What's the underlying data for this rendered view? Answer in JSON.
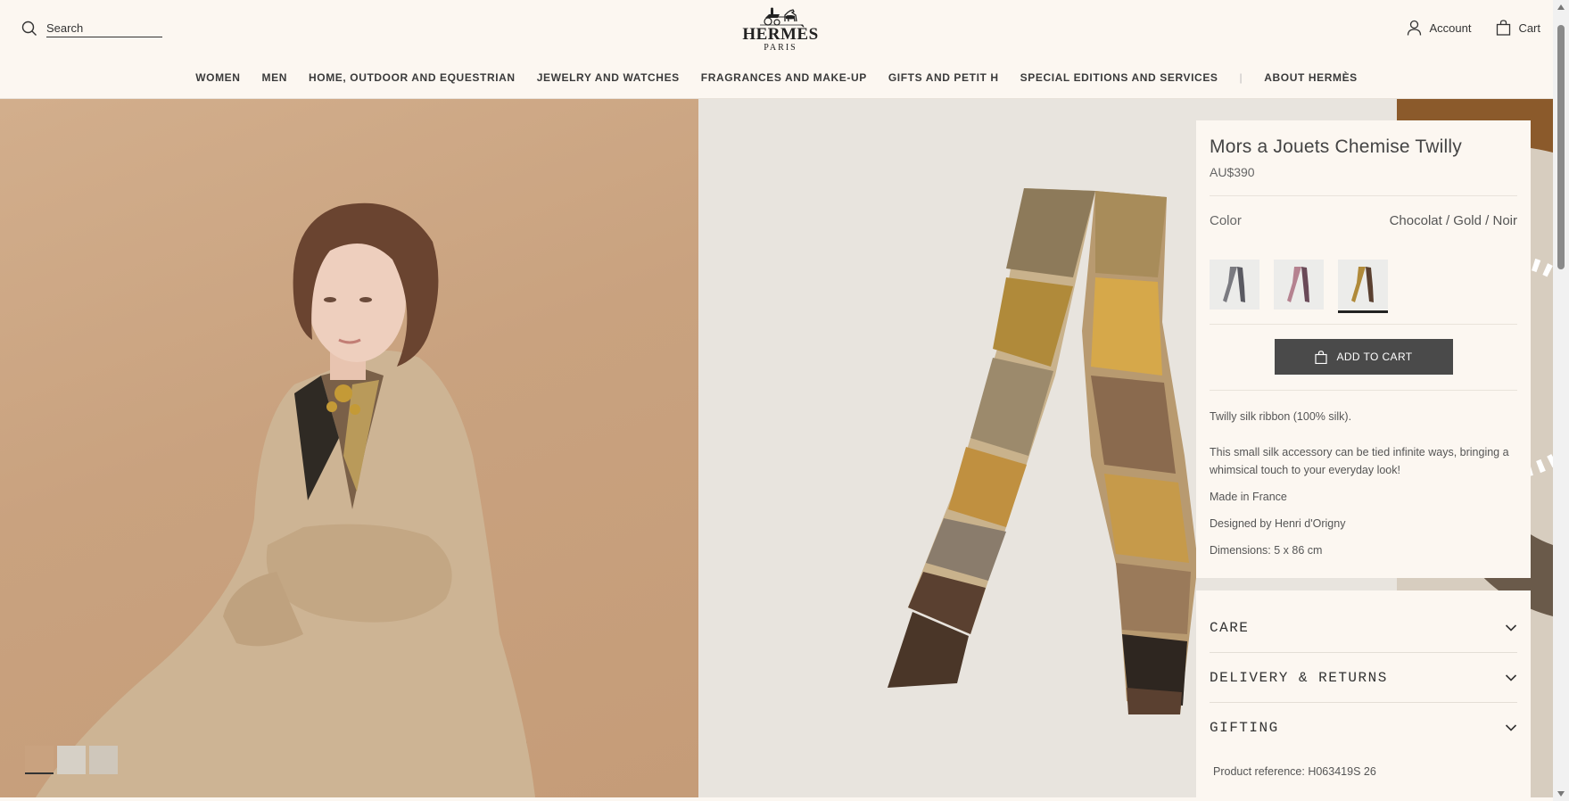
{
  "header": {
    "search_placeholder": "Search",
    "logo": {
      "main": "HERMÈS",
      "sub": "PARIS"
    },
    "account_label": "Account",
    "cart_label": "Cart"
  },
  "nav": {
    "items": [
      "WOMEN",
      "MEN",
      "HOME, OUTDOOR AND EQUESTRIAN",
      "JEWELRY AND WATCHES",
      "FRAGRANCES AND MAKE-UP",
      "GIFTS AND PETIT H",
      "SPECIAL EDITIONS AND SERVICES"
    ],
    "about": "ABOUT HERMÈS"
  },
  "product": {
    "title": "Mors a Jouets Chemise Twilly",
    "price": "AU$390",
    "color_label": "Color",
    "color_value": "Chocolat / Gold / Noir",
    "swatch_selected_index": 2,
    "add_to_cart": "ADD TO CART",
    "description": {
      "line1": "Twilly silk ribbon (100% silk).",
      "line2": "This small silk accessory can be tied infinite ways, bringing a whimsical touch to your everyday look!",
      "line3": "Made in France",
      "line4": "Designed by Henri d'Origny",
      "line5": "Dimensions: 5 x 86 cm"
    }
  },
  "accordion": {
    "items": [
      "CARE",
      "DELIVERY & RETURNS",
      "GIFTING"
    ],
    "reference_label": "Product reference:",
    "reference_value": "H063419S 26"
  },
  "colors": {
    "background": "#fcf7f1",
    "button": "#4a4a4a",
    "left_photo": "#c9a27f",
    "right_photo": "#e8e4de"
  }
}
